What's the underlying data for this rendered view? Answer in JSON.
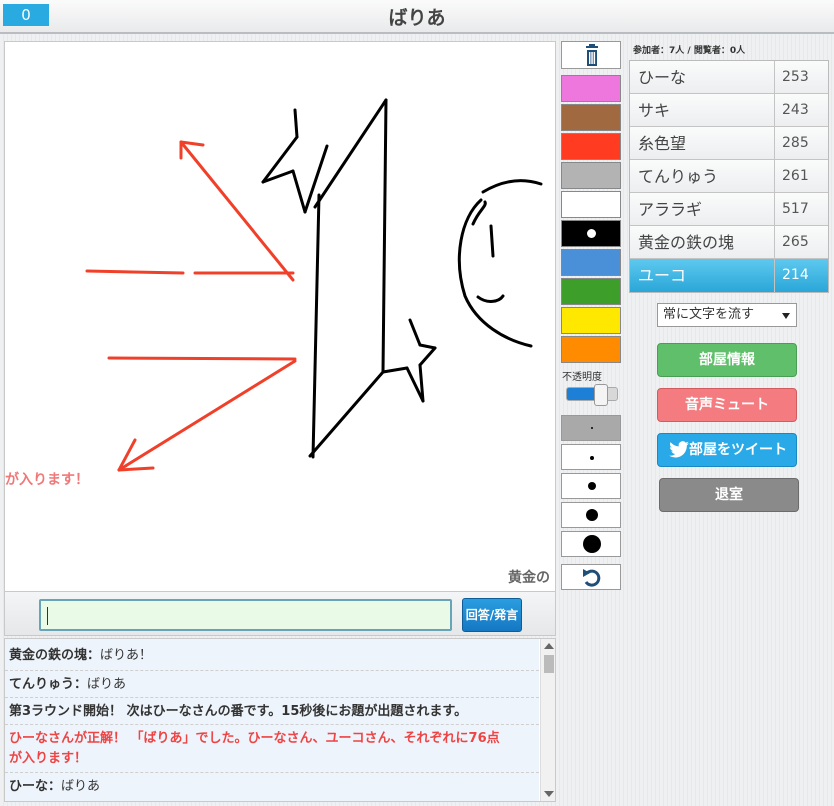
{
  "header": {
    "counter": "0",
    "title": "ばりあ"
  },
  "canvas": {
    "scroll_text_red": "が入ります！",
    "scroll_text_gray": "黄金の"
  },
  "tools": {
    "trash_icon": "trash-icon",
    "colors": [
      "#ee77dd",
      "#a0693f",
      "#ff3b22",
      "#b3b3b3",
      "#ffffff",
      "#000000",
      "#4a90d9",
      "#3d9e2a",
      "#ffe800",
      "#ff8c00"
    ],
    "selected_color": "#000000",
    "opacity_label": "不透明度",
    "opacity_value": 0.6,
    "brush_sizes": [
      "1",
      "2",
      "3",
      "4",
      "5"
    ],
    "selected_size_index": 0,
    "undo_icon": "undo-icon"
  },
  "answer": {
    "value": "",
    "button_label": "回答/発言"
  },
  "chat": {
    "messages": [
      {
        "who": "黄金の鉄の塊：",
        "text": "ばりあ！"
      },
      {
        "who": "てんりゅう：",
        "text": "ばりあ"
      },
      {
        "who": "",
        "text": "第3ラウンド開始！ 次はひーなさんの番です。15秒後にお題が出題されます。"
      },
      {
        "who": "",
        "text": "ひーなさんが正解！ 「ばりあ」でした。ひーなさん、ユーコさん、それぞれに76点",
        "text2": "が入ります！"
      },
      {
        "who": "ひーな：",
        "text": "ばりあ"
      }
    ]
  },
  "sidebar": {
    "stats_label_participants": "参加者：",
    "participants": "7人",
    "stats_sep": " / ",
    "stats_label_viewers": "閲覧者：",
    "viewers": "0人",
    "players": [
      {
        "name": "ひーな",
        "score": "253",
        "active": false
      },
      {
        "name": "サキ",
        "score": "243",
        "active": false
      },
      {
        "name": "糸色望",
        "score": "285",
        "active": false
      },
      {
        "name": "てんりゅう",
        "score": "261",
        "active": false
      },
      {
        "name": "アララギ",
        "score": "517",
        "active": false
      },
      {
        "name": "黄金の鉄の塊",
        "score": "265",
        "active": false
      },
      {
        "name": "ユーコ",
        "score": "214",
        "active": true
      }
    ],
    "text_mode_select": "常に文字を流す",
    "room_info_button": "部屋情報",
    "mute_button": "音声ミュート",
    "tweet_button": "部屋をツイート",
    "tweet_icon": "twitter-bird-icon",
    "leave_button": "退室"
  }
}
